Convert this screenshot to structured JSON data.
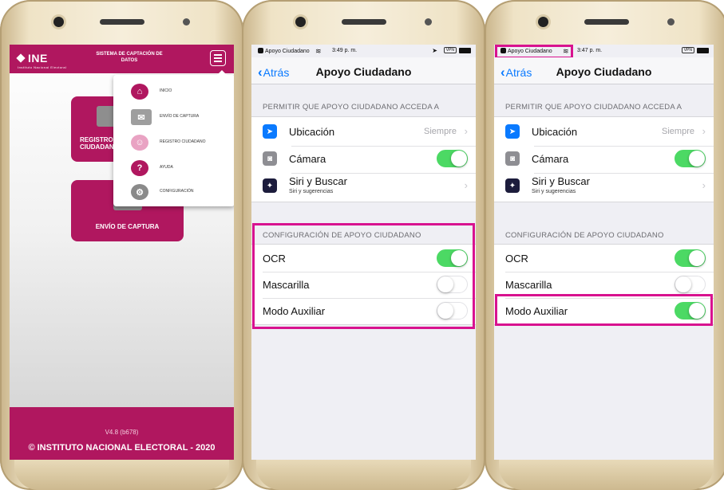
{
  "colors": {
    "brand": "#b0175f",
    "ios_blue": "#0a7aff",
    "toggle_on": "#4cd964",
    "highlight": "#d8128f"
  },
  "app": {
    "logo": "INE",
    "logo_sub": "Instituto Nacional Electoral",
    "header_title": "SISTEMA DE CAPTACIÓN DE DATOS",
    "menu_icon": "hamburger-menu-icon",
    "tiles": {
      "registro": "REGISTRO CIUDADANO",
      "envio": "ENVÍO DE CAPTURA"
    },
    "menu": [
      {
        "label": "INICIO",
        "icon": "home-icon"
      },
      {
        "label": "ENVÍO DE CAPTURA",
        "icon": "envelope-icon"
      },
      {
        "label": "REGISTRO CIUDADANO",
        "icon": "citizen-icon"
      },
      {
        "label": "AYUDA",
        "icon": "help-icon"
      },
      {
        "label": "CONFIGURACIÓN",
        "icon": "gears-icon"
      }
    ],
    "version": "V4.8 (b678)",
    "copyright": "© INSTITUTO NACIONAL ELECTORAL - 2020"
  },
  "settings_screens": [
    {
      "status": {
        "back_app": "Apoyo Ciudadano",
        "time": "3:49 p. m.",
        "vpn": "VPN"
      },
      "nav": {
        "back": "Atrás",
        "title": "Apoyo Ciudadano"
      },
      "permissions_header": "PERMITIR QUE APOYO CIUDADANO ACCEDA A",
      "permissions": [
        {
          "label": "Ubicación",
          "value": "Siempre",
          "icon": "location-arrow-icon"
        },
        {
          "label": "Cámara",
          "toggle": true,
          "icon": "camera-icon"
        },
        {
          "label": "Siri y Buscar",
          "sublabel": "Siri y sugerencias",
          "icon": "siri-icon"
        }
      ],
      "config_header": "CONFIGURACIÓN DE APOYO CIUDADANO",
      "config": [
        {
          "label": "OCR",
          "toggle": true
        },
        {
          "label": "Mascarilla",
          "toggle": false
        },
        {
          "label": "Modo Auxiliar",
          "toggle": false
        }
      ]
    },
    {
      "status": {
        "back_app": "Apoyo Ciudadano",
        "time": "3:47 p. m.",
        "vpn": "VPN"
      },
      "nav": {
        "back": "Atrás",
        "title": "Apoyo Ciudadano"
      },
      "permissions_header": "PERMITIR QUE APOYO CIUDADANO ACCEDA A",
      "permissions": [
        {
          "label": "Ubicación",
          "value": "Siempre",
          "icon": "location-arrow-icon"
        },
        {
          "label": "Cámara",
          "toggle": true,
          "icon": "camera-icon"
        },
        {
          "label": "Siri y Buscar",
          "sublabel": "Siri y sugerencias",
          "icon": "siri-icon"
        }
      ],
      "config_header": "CONFIGURACIÓN DE APOYO CIUDADANO",
      "config": [
        {
          "label": "OCR",
          "toggle": true
        },
        {
          "label": "Mascarilla",
          "toggle": false
        },
        {
          "label": "Modo Auxiliar",
          "toggle": true
        }
      ]
    }
  ]
}
